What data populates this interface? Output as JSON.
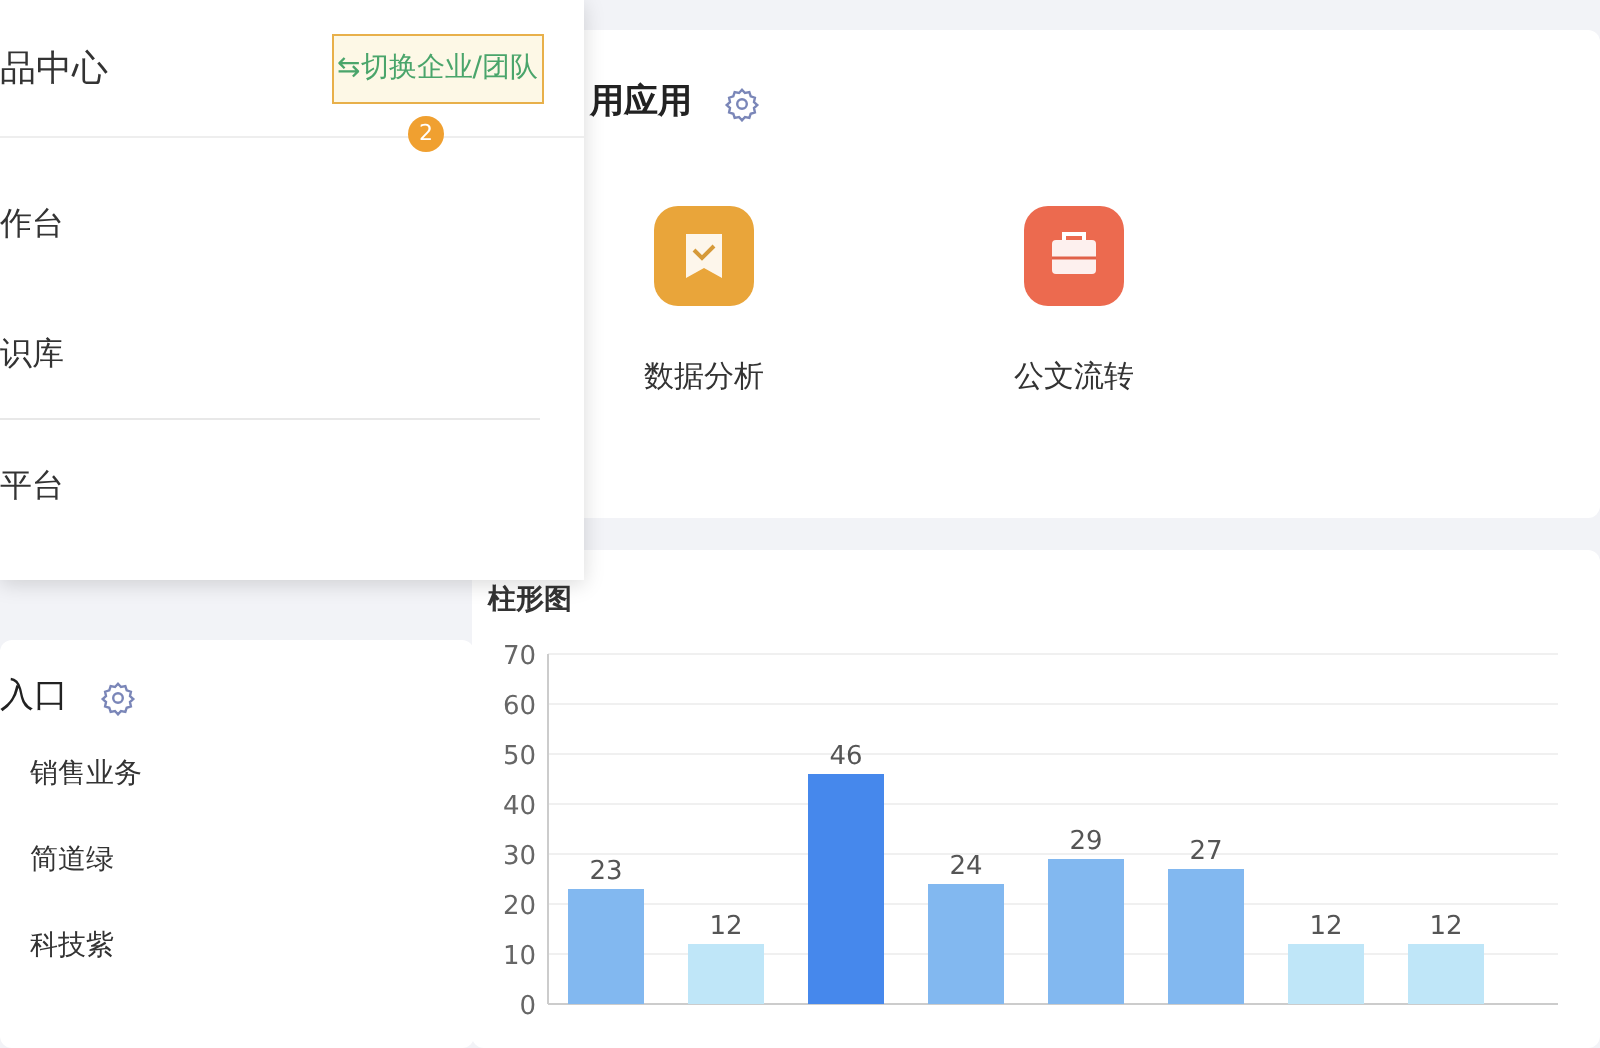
{
  "product_panel": {
    "title": "品中心",
    "switch_button": "⇆切换企业/团队",
    "step_badge": "2",
    "items": [
      {
        "label": "作台",
        "divider_after": false
      },
      {
        "label": "识库",
        "divider_after": true
      },
      {
        "label": "平台",
        "divider_after": false
      }
    ]
  },
  "entry_card": {
    "title": "入口",
    "items": [
      "销售业务",
      "简道绿",
      "科技紫"
    ]
  },
  "common_apps": {
    "title": "用应用",
    "apps": [
      {
        "label": "数据分析",
        "kind": "bookmark",
        "color": "#e9a53a"
      },
      {
        "label": "公文流转",
        "kind": "briefcase",
        "color": "#ec6a4f"
      }
    ]
  },
  "bar_chart": {
    "title": "柱形图",
    "chart_data": {
      "type": "bar",
      "values": [
        23,
        12,
        46,
        24,
        29,
        27,
        12,
        12
      ],
      "ylim": [
        0,
        70
      ],
      "grid": true,
      "yticks": [
        0,
        10,
        20,
        30,
        40,
        50,
        60,
        70
      ],
      "data_labels": true
    }
  }
}
